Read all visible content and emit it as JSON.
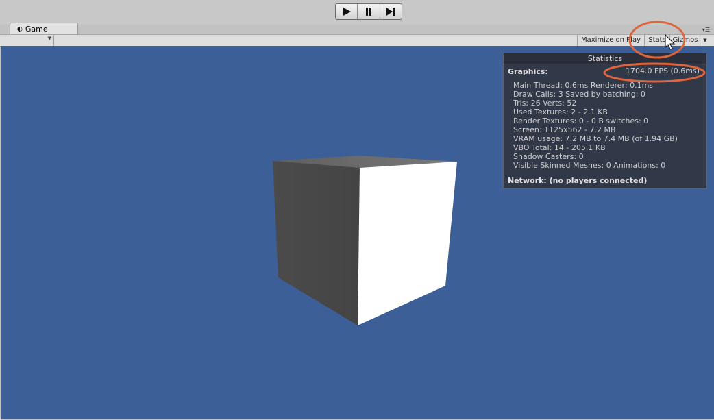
{
  "play_controls": {
    "play_icon": "play-icon",
    "pause_icon": "pause-icon",
    "step_icon": "step-icon"
  },
  "tab": {
    "label": "Game",
    "icon": "game-controller-icon"
  },
  "toolbar": {
    "maximize_label": "Maximize on Play",
    "stats_label": "Stats",
    "gizmos_label": "Gizmos"
  },
  "stats": {
    "title": "Statistics",
    "graphics_label": "Graphics:",
    "fps": "1704.0 FPS (0.6ms)",
    "lines": [
      "Main Thread: 0.6ms  Renderer: 0.1ms",
      "Draw Calls: 3   Saved by batching: 0",
      "Tris: 26    Verts: 52",
      "Used Textures: 2 - 2.1 KB",
      "Render Textures: 0 - 0 B   switches: 0",
      "Screen: 1125x562 - 7.2 MB",
      "VRAM usage: 7.2 MB to 7.4 MB (of 1.94 GB)",
      "VBO Total: 14 - 205.1 KB",
      "Shadow Casters: 0",
      "Visible Skinned Meshes: 0      Animations: 0"
    ],
    "network": "Network: (no players connected)"
  },
  "colors": {
    "viewport": "#3c5f98",
    "highlight": "#e0643c"
  }
}
